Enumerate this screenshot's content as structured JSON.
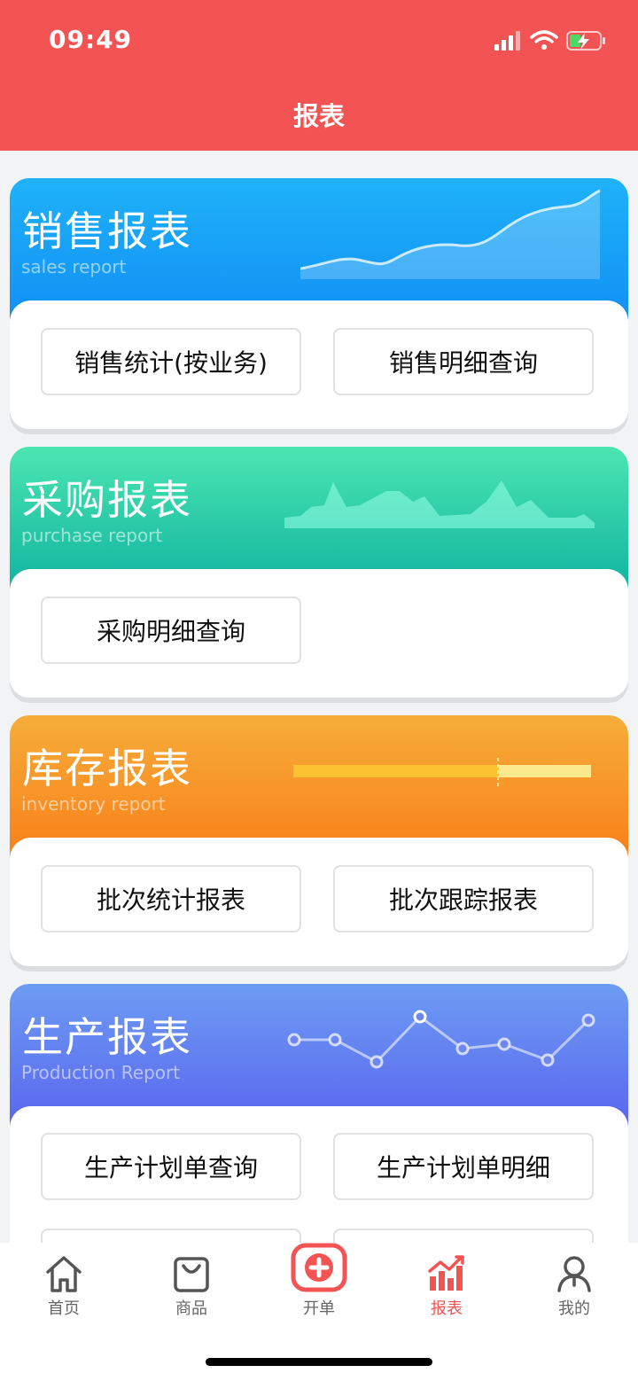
{
  "status_bar": {
    "time": "09:49"
  },
  "header": {
    "title": "报表"
  },
  "cards": [
    {
      "title": "销售报表",
      "subtitle": "sales report",
      "buttons": [
        "销售统计(按业务)",
        "销售明细查询"
      ]
    },
    {
      "title": "采购报表",
      "subtitle": "purchase report",
      "buttons": [
        "采购明细查询"
      ]
    },
    {
      "title": "库存报表",
      "subtitle": "inventory report",
      "buttons": [
        "批次统计报表",
        "批次跟踪报表"
      ]
    },
    {
      "title": "生产报表",
      "subtitle": "Production Report",
      "buttons": [
        "生产计划单查询",
        "生产计划单明细"
      ]
    }
  ],
  "tabbar": {
    "items": [
      {
        "label": "首页",
        "icon": "home-icon"
      },
      {
        "label": "商品",
        "icon": "bag-icon"
      },
      {
        "label": "开单",
        "icon": "plus-box-icon"
      },
      {
        "label": "报表",
        "icon": "chart-icon",
        "active": true
      },
      {
        "label": "我的",
        "icon": "user-icon"
      }
    ]
  },
  "colors": {
    "header": "#f45354",
    "sales": [
      "#1fb2f8",
      "#1190f6"
    ],
    "purchase": [
      "#4be6b1",
      "#11b4a0"
    ],
    "inventory": [
      "#f6ad3a",
      "#f98019"
    ],
    "production": [
      "#6d9cf3",
      "#5a66ee"
    ],
    "active_tab": "#f45354"
  }
}
